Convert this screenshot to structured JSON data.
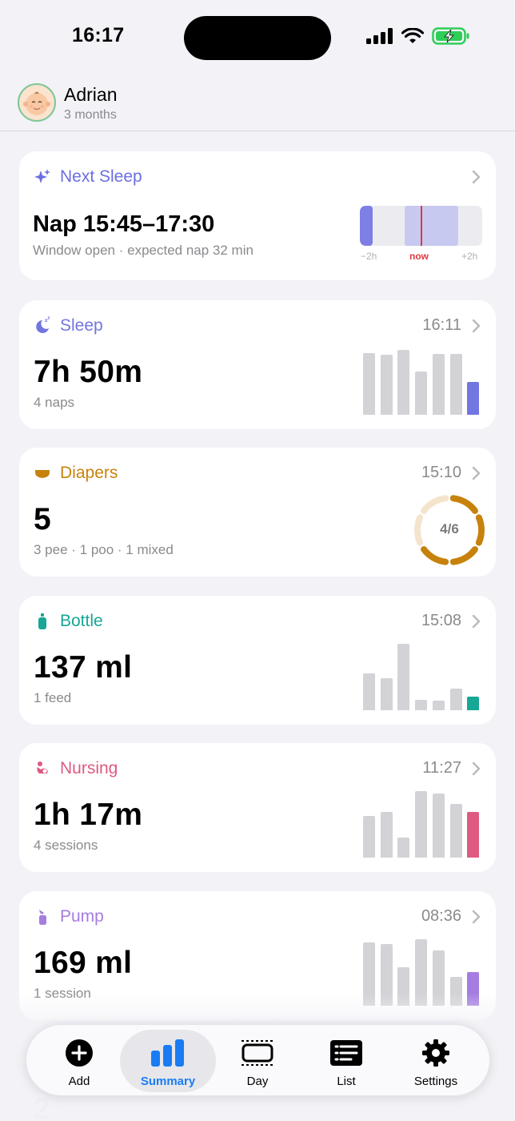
{
  "status_bar": {
    "time": "16:17"
  },
  "header": {
    "name": "Adrian",
    "age": "3 months"
  },
  "next_sleep": {
    "title": "Next Sleep",
    "color": "#6b6fe0",
    "value": "Nap 15:45–17:30",
    "subtitle": "Window open · expected nap 32 min",
    "timeline_labels": {
      "left": "−2h",
      "now": "now",
      "right": "+2h"
    }
  },
  "cards": [
    {
      "id": "sleep",
      "title": "Sleep",
      "time": "16:11",
      "value": "7h 50m",
      "subtitle": "4 naps",
      "color": "#7276e0",
      "icon": "moon-zzz-icon",
      "bars": [
        0.88,
        0.86,
        0.93,
        0.62,
        0.87,
        0.87,
        0.47
      ]
    },
    {
      "id": "diapers",
      "title": "Diapers",
      "time": "15:10",
      "value": "5",
      "subtitle": "3 pee · 1 poo · 1 mixed",
      "color": "#c7820d",
      "icon": "diaper-icon",
      "progress_label": "4/6",
      "progress": 0.6667
    },
    {
      "id": "bottle",
      "title": "Bottle",
      "time": "15:08",
      "value": "137 ml",
      "subtitle": "1 feed",
      "color": "#18a695",
      "icon": "bottle-icon",
      "bars": [
        0.53,
        0.46,
        0.95,
        0.15,
        0.14,
        0.31,
        0.19
      ]
    },
    {
      "id": "nursing",
      "title": "Nursing",
      "time": "11:27",
      "value": "1h 17m",
      "subtitle": "4 sessions",
      "color": "#de5a80",
      "icon": "nursing-icon",
      "bars": [
        0.6,
        0.65,
        0.29,
        0.95,
        0.92,
        0.77,
        0.66
      ]
    },
    {
      "id": "pump",
      "title": "Pump",
      "time": "08:36",
      "value": "169 ml",
      "subtitle": "1 session",
      "color": "#a57de0",
      "icon": "pump-icon",
      "bars": [
        0.91,
        0.88,
        0.55,
        0.95,
        0.79,
        0.41,
        0.48
      ]
    }
  ],
  "ghost": {
    "value": "2"
  },
  "tabs": [
    {
      "id": "add",
      "label": "Add",
      "icon": "plus-circle-icon"
    },
    {
      "id": "summary",
      "label": "Summary",
      "icon": "chart-bars-icon",
      "active": true
    },
    {
      "id": "day",
      "label": "Day",
      "icon": "day-timeline-icon"
    },
    {
      "id": "list",
      "label": "List",
      "icon": "list-icon"
    },
    {
      "id": "settings",
      "label": "Settings",
      "icon": "gear-icon"
    }
  ]
}
